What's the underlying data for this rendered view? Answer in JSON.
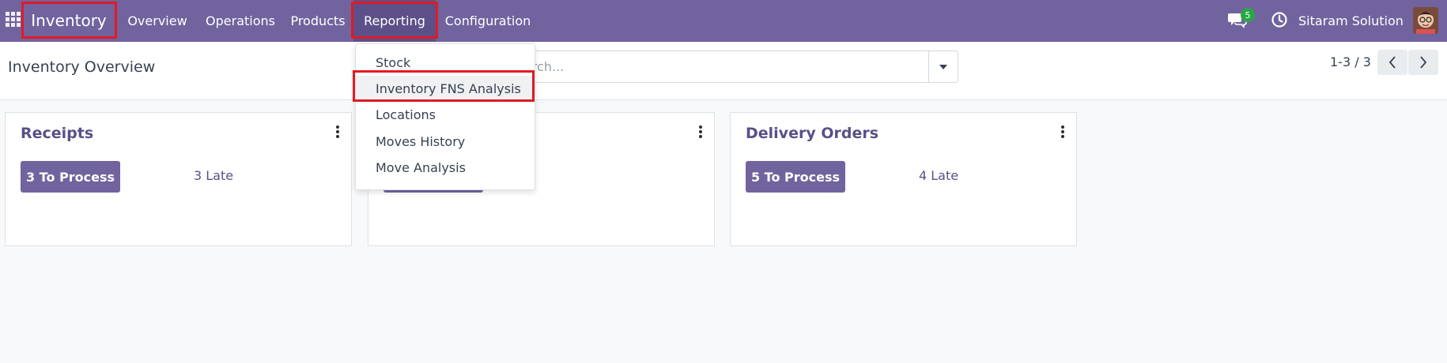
{
  "navbar": {
    "app_title": "Inventory",
    "menu": [
      {
        "label": "Overview"
      },
      {
        "label": "Operations"
      },
      {
        "label": "Products"
      },
      {
        "label": "Reporting"
      },
      {
        "label": "Configuration"
      }
    ],
    "active_menu": "Reporting",
    "messages_count": "5",
    "company": "Sitaram Solution",
    "accent_color": "#71639e",
    "icons": [
      "apps-grid-icon",
      "chat-icon",
      "clock-icon"
    ]
  },
  "control_panel": {
    "breadcrumb": "Inventory Overview",
    "search_placeholder": "Search...",
    "search_visible_text": "arch...",
    "pager": "1-3 / 3"
  },
  "reporting_menu": {
    "items": [
      {
        "label": "Stock"
      },
      {
        "label": "Inventory FNS Analysis"
      },
      {
        "label": "Locations"
      },
      {
        "label": "Moves History"
      },
      {
        "label": "Move Analysis"
      }
    ],
    "highlighted": "Inventory FNS Analysis"
  },
  "cards": [
    {
      "title": "Receipts",
      "process_label": "3 To Process",
      "late_label": "3 Late"
    },
    {
      "title": "",
      "process_label": "",
      "late_label": ""
    },
    {
      "title": "Delivery Orders",
      "process_label": "5 To Process",
      "late_label": "4 Late"
    }
  ],
  "highlight_color": "#e01b24"
}
